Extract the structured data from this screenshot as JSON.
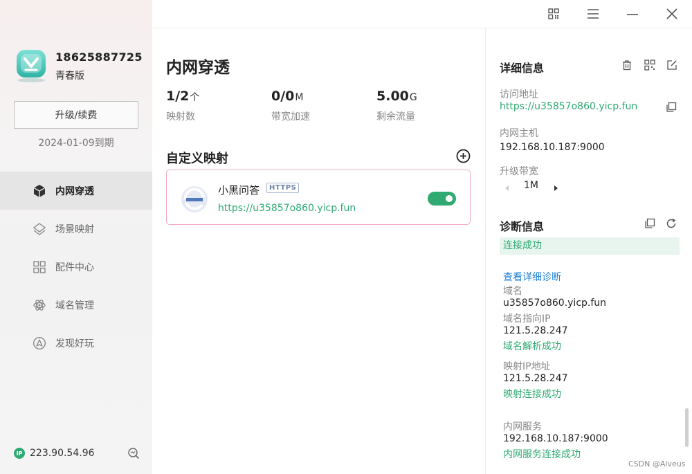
{
  "user": {
    "phone": "18625887725",
    "edition": "青春版",
    "upgrade_label": "升级/续费",
    "expire": "2024-01-09到期"
  },
  "nav": {
    "items": [
      {
        "label": "内网穿透",
        "icon": "cube-icon",
        "active": true
      },
      {
        "label": "场景映射",
        "icon": "scene-icon",
        "active": false
      },
      {
        "label": "配件中心",
        "icon": "grid-icon",
        "active": false
      },
      {
        "label": "域名管理",
        "icon": "atom-icon",
        "active": false
      },
      {
        "label": "发现好玩",
        "icon": "compass-icon",
        "active": false
      }
    ]
  },
  "footer": {
    "ip_badge": "IP",
    "ip": "223.90.54.96"
  },
  "main": {
    "title": "内网穿透",
    "stats": [
      {
        "value": "1/2",
        "unit": "个",
        "label": "映射数"
      },
      {
        "value": "0/0",
        "unit": "M",
        "label": "带宽加速"
      },
      {
        "value": "5.00",
        "unit": "G",
        "label": "剩余流量"
      }
    ],
    "section_title": "自定义映射",
    "mapping": {
      "name": "小黑问答",
      "protocol": "HTTPS",
      "url": "https://u35857o860.yicp.fun",
      "enabled": true
    }
  },
  "detail": {
    "title": "详细信息",
    "access_label": "访问地址",
    "access_url": "https://u35857o860.yicp.fun",
    "host_label": "内网主机",
    "host": "192.168.10.187:9000",
    "bw_label": "升级带宽",
    "bw_value": "1M"
  },
  "diag": {
    "title": "诊断信息",
    "status": "连接成功",
    "link": "查看详细诊断",
    "domain_label": "域名",
    "domain": "u35857o860.yicp.fun",
    "domain_ip_label": "域名指向IP",
    "domain_ip": "121.5.28.247",
    "domain_ok": "域名解析成功",
    "map_ip_label": "映射IP地址",
    "map_ip": "121.5.28.247",
    "map_ok": "映射连接成功",
    "svc_label": "内网服务",
    "svc": "192.168.10.187:9000",
    "svc_ok": "内网服务连接成功"
  },
  "watermark": "CSDN @Alveus",
  "colors": {
    "accent": "#2eaa72",
    "link": "#1f7fd6",
    "card_border": "#f0a8c0"
  }
}
